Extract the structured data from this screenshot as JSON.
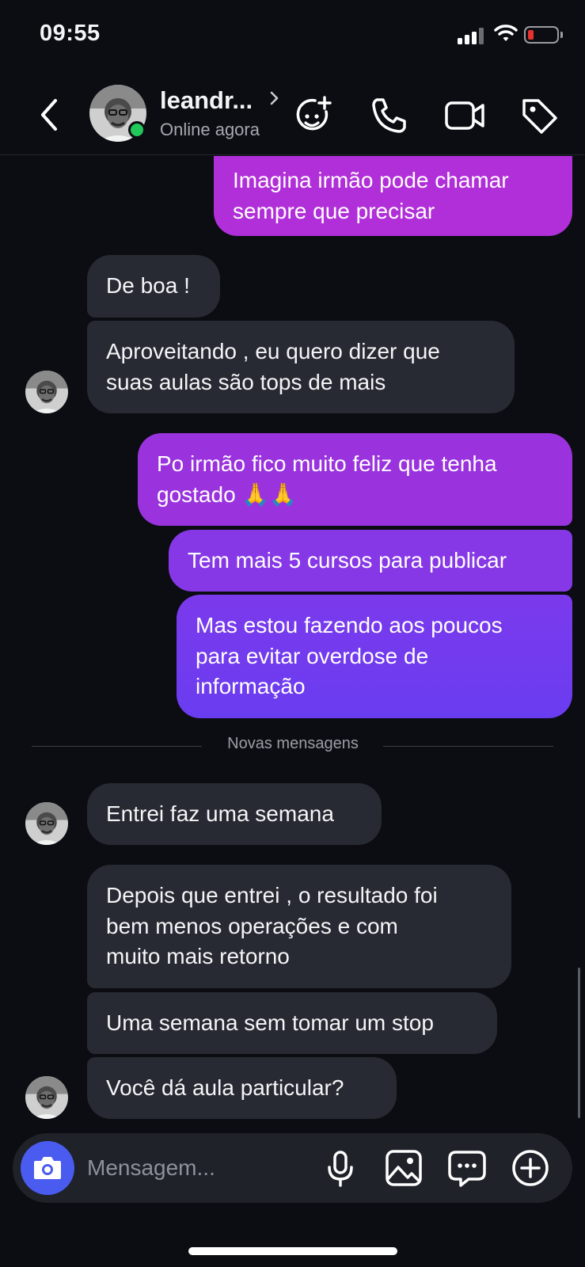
{
  "status_bar": {
    "time": "09:55",
    "icons": [
      "signal-icon",
      "wifi-icon",
      "battery-low-icon"
    ],
    "battery_color": "#e5322f"
  },
  "header": {
    "back_icon": "chevron-left-icon",
    "contact_name": "leandr...",
    "contact_status": "Online agora",
    "online_color": "#22c95a",
    "actions": [
      "add-effect-icon",
      "phone-icon",
      "video-camera-icon",
      "tag-icon"
    ]
  },
  "messages": [
    {
      "direction": "outgoing",
      "text": "Imagina irmão pode chamar\nsempre que precisar"
    },
    {
      "direction": "incoming",
      "text": "De boa !"
    },
    {
      "direction": "incoming",
      "text": "Aproveitando , eu quero dizer que\nsuas aulas são tops de mais"
    },
    {
      "direction": "outgoing",
      "text": "Po irmão fico muito feliz que tenha\ngostado 🙏🙏"
    },
    {
      "direction": "outgoing",
      "text": "Tem mais 5 cursos para publicar"
    },
    {
      "direction": "outgoing",
      "text": "Mas estou fazendo aos poucos\npara evitar overdose de\ninformação"
    },
    {
      "direction": "incoming",
      "text": "Entrei faz uma semana"
    },
    {
      "direction": "incoming",
      "text": "Depois que entrei , o resultado foi\nbem menos operações e com\nmuito mais retorno"
    },
    {
      "direction": "incoming",
      "text": "Uma semana sem tomar um stop"
    },
    {
      "direction": "incoming",
      "text": "Você dá aula particular?"
    }
  ],
  "divider": {
    "label": "Novas mensagens"
  },
  "composer": {
    "placeholder": "Mensagem...",
    "icons": [
      "camera-icon",
      "microphone-icon",
      "image-icon",
      "sticker-chat-icon",
      "plus-circle-icon"
    ],
    "camera_color": "#4a5cf0"
  },
  "colors": {
    "background": "#0b0d12",
    "incoming_bubble": "#272a32",
    "outgoing_gradient_top": "#b12fd8",
    "outgoing_gradient_bottom": "#6a3cf0"
  }
}
